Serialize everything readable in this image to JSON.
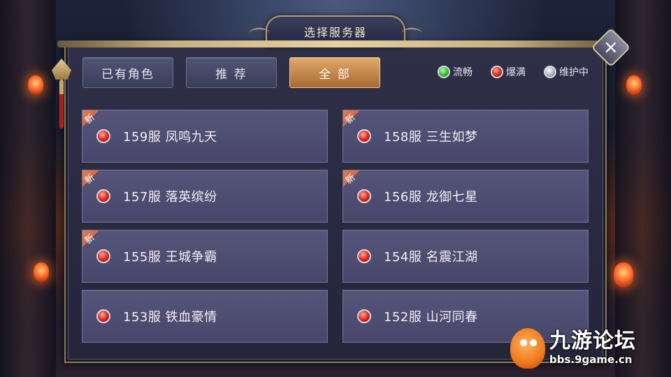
{
  "title": "选择服务器",
  "close_icon": "×",
  "tabs": [
    {
      "label": "已有角色",
      "active": false
    },
    {
      "label": "推 荐",
      "active": false
    },
    {
      "label": "全 部",
      "active": true
    }
  ],
  "legend": [
    {
      "label": "流畅",
      "color": "green"
    },
    {
      "label": "爆满",
      "color": "red"
    },
    {
      "label": "维护中",
      "color": "gray"
    }
  ],
  "new_badge_label": "新",
  "servers": [
    {
      "name": "159服 凤鸣九天",
      "status": "red",
      "is_new": true
    },
    {
      "name": "158服 三生如梦",
      "status": "red",
      "is_new": true
    },
    {
      "name": "157服 落英缤纷",
      "status": "red",
      "is_new": true
    },
    {
      "name": "156服 龙御七星",
      "status": "red",
      "is_new": true
    },
    {
      "name": "155服 王城争霸",
      "status": "red",
      "is_new": true
    },
    {
      "name": "154服 名震江湖",
      "status": "red",
      "is_new": false
    },
    {
      "name": "153服 铁血豪情",
      "status": "red",
      "is_new": false
    },
    {
      "name": "152服 山河同春",
      "status": "red",
      "is_new": false
    }
  ],
  "watermark": {
    "title": "九游论坛",
    "url": "bbs.9game.cn"
  },
  "colors": {
    "accent": "#c88a4a",
    "panel": "#2f3048",
    "server_card": "#4f4f74"
  }
}
